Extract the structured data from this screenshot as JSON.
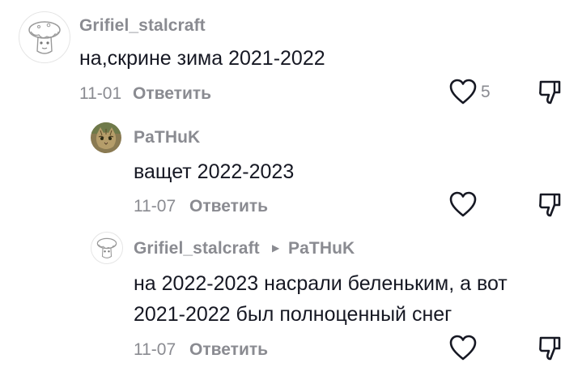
{
  "comments": [
    {
      "author": "Grifiel_stalcraft",
      "text": "на,скрине зима 2021-2022",
      "date": "11-01",
      "reply_label": "Ответить",
      "like_count": "5",
      "avatar_icon": "mushroom-sketch-avatar"
    },
    {
      "author": "PaTHuK",
      "text": "ващет 2022-2023",
      "date": "11-07",
      "reply_label": "Ответить",
      "avatar_icon": "cat-photo-avatar"
    },
    {
      "author": "Grifiel_stalcraft",
      "reply_to": "PaTHuK",
      "text_line1": "на 2022-2023 насрали беленьким, а вот",
      "text_line2": "2021-2022 был полноценный снег",
      "date": "11-07",
      "reply_label": "Ответить",
      "avatar_icon": "mushroom-sketch-avatar"
    }
  ],
  "colors": {
    "text": "#161823",
    "secondary": "#8a8b91",
    "icon": "#161823"
  }
}
